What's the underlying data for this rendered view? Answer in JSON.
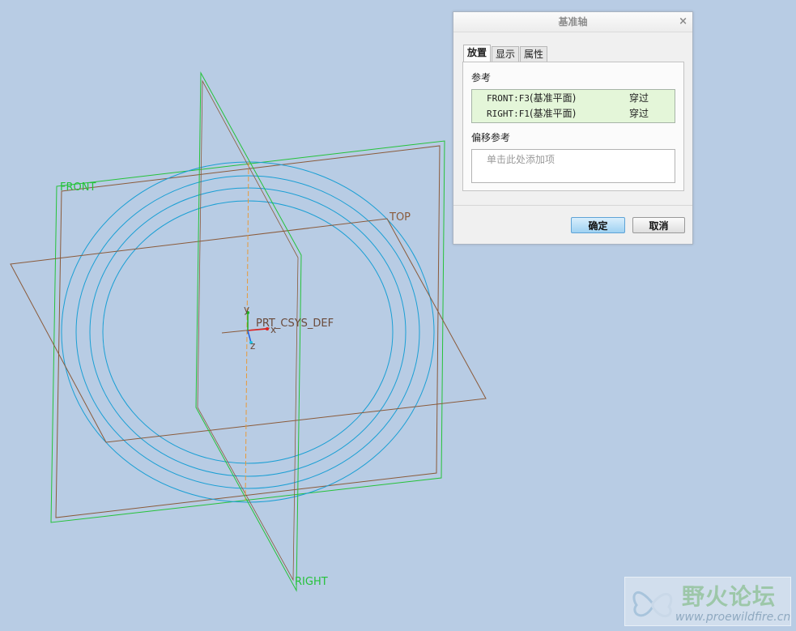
{
  "viewport": {
    "plane_labels": {
      "front": "FRONT",
      "top": "TOP",
      "right": "RIGHT"
    },
    "csys": {
      "label": "PRT_CSYS_DEF",
      "x": "x",
      "y": "y",
      "z": "z"
    },
    "colors": {
      "background": "#b8cce4",
      "front_plane": "#25c23a",
      "top_plane": "#8a5a3a",
      "right_plane": "#25c23a",
      "circles": "#1a9fd4",
      "axis_preview": "#e89a3a"
    }
  },
  "dialog": {
    "title": "基准轴",
    "close_glyph": "×",
    "tabs": [
      "放置",
      "显示",
      "属性"
    ],
    "active_tab": "放置",
    "references_label": "参考",
    "references": [
      {
        "name": "FRONT:F3",
        "suffix": "(基准平面)",
        "type": "穿过"
      },
      {
        "name": "RIGHT:F1",
        "suffix": "(基准平面)",
        "type": "穿过"
      }
    ],
    "offset_label": "偏移参考",
    "offset_placeholder": "单击此处添加项",
    "ok_label": "确定",
    "cancel_label": "取消"
  },
  "watermark": {
    "cn": "野火论坛",
    "url": "www.proewildfire.cn"
  }
}
